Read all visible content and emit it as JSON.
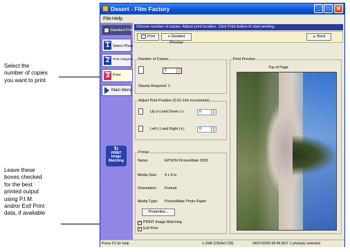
{
  "annotations": {
    "copies": [
      "Select the",
      "number of copies",
      "you want to print"
    ],
    "checkboxes": [
      "Leave these",
      "boxes checked",
      "for the best",
      "printed output",
      "using P.I.M.",
      "and/or Exif Print",
      "data, if available"
    ]
  },
  "window": {
    "title": "Desert - Film Factory",
    "menu": [
      "File",
      "Help"
    ]
  },
  "sidebar": {
    "items": [
      {
        "step": "",
        "num": "",
        "label": "Standard Prints"
      },
      {
        "step": "Step",
        "num": "1",
        "label": "Select Photos"
      },
      {
        "step": "Step",
        "num": "2",
        "label": "Print Assignment"
      },
      {
        "step": "Step",
        "num": "3",
        "label": "Print"
      },
      {
        "step": "",
        "num": "",
        "label": "Main Menu"
      }
    ],
    "logo": [
      "PRINT",
      "Image",
      "Matching"
    ]
  },
  "instruction": "Choose number of copies. Adjust print location. Click Print button to start printing.",
  "toolbar": {
    "print_label": "Print",
    "detailed_label": "Detailed Preview",
    "back_label": "Back"
  },
  "copies": {
    "legend": "Number of Copies",
    "value": "1",
    "sheets_required": "Sheets Required: 1"
  },
  "position": {
    "legend": "Adjust Print Position (0.01 inch increments)",
    "updown_label": "Up (+) and Down (-):",
    "updown_value": "0",
    "leftright_label": "Left (-) and Right (+):",
    "leftright_value": "0"
  },
  "printer": {
    "legend": "Printer",
    "rows": [
      {
        "k": "Name:",
        "v": "EPSON PictureMate 2005"
      },
      {
        "k": "Media Size:",
        "v": "4 x 6 in"
      },
      {
        "k": "Orientation:",
        "v": "Portrait"
      },
      {
        "k": "Media Type:",
        "v": "PictureMate Photo Paper"
      }
    ],
    "properties_label": "Properties...",
    "pim_label": "PRINT Image Matching",
    "exif_label": "Exif Print"
  },
  "preview": {
    "legend": "Print Preview",
    "top_label": "Top of Page"
  },
  "status": {
    "help": "Press F1 for help",
    "size": "1.1MB (2304x1728)",
    "info": "04/07/2005 08:46:58 F 1 photo(s) selected"
  }
}
